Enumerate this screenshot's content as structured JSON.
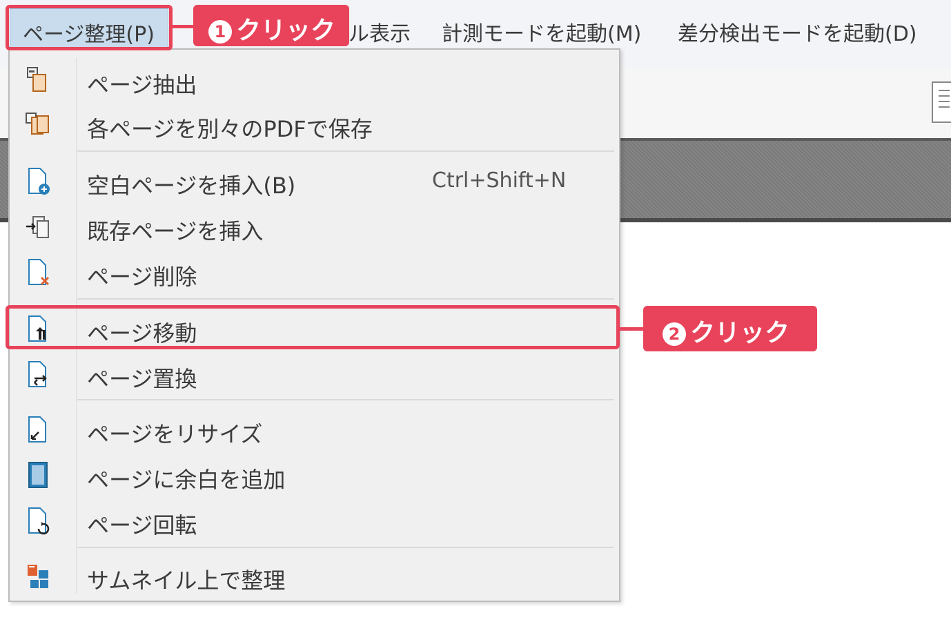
{
  "menubar": {
    "items": [
      {
        "label": "ページ整理(P)"
      },
      {
        "label": "ル表示"
      },
      {
        "label": "計測モードを起動(M)"
      },
      {
        "label": "差分検出モードを起動(D)"
      }
    ]
  },
  "menu": {
    "items": [
      {
        "label": "ページ抽出",
        "icon": "page-extract-icon"
      },
      {
        "label": "各ページを別々のPDFで保存",
        "icon": "save-separate-pdf-icon"
      },
      {
        "label": "空白ページを挿入(B)",
        "shortcut": "Ctrl+Shift+N",
        "icon": "insert-blank-page-icon"
      },
      {
        "label": "既存ページを挿入",
        "icon": "insert-existing-page-icon"
      },
      {
        "label": "ページ削除",
        "icon": "delete-page-icon"
      },
      {
        "label": "ページ移動",
        "icon": "move-page-icon"
      },
      {
        "label": "ページ置換",
        "icon": "replace-page-icon"
      },
      {
        "label": "ページをリサイズ",
        "icon": "resize-page-icon"
      },
      {
        "label": "ページに余白を追加",
        "icon": "add-margin-icon"
      },
      {
        "label": "ページ回転",
        "icon": "rotate-page-icon"
      },
      {
        "label": "サムネイル上で整理",
        "icon": "thumbnail-organize-icon"
      }
    ]
  },
  "callouts": {
    "step1": {
      "number": "1",
      "text": "クリック"
    },
    "step2": {
      "number": "2",
      "text": "クリック"
    }
  },
  "colors": {
    "highlight": "#e8435a",
    "menubar_active": "#c8dcee",
    "menu_bg": "#f0f0f0"
  }
}
